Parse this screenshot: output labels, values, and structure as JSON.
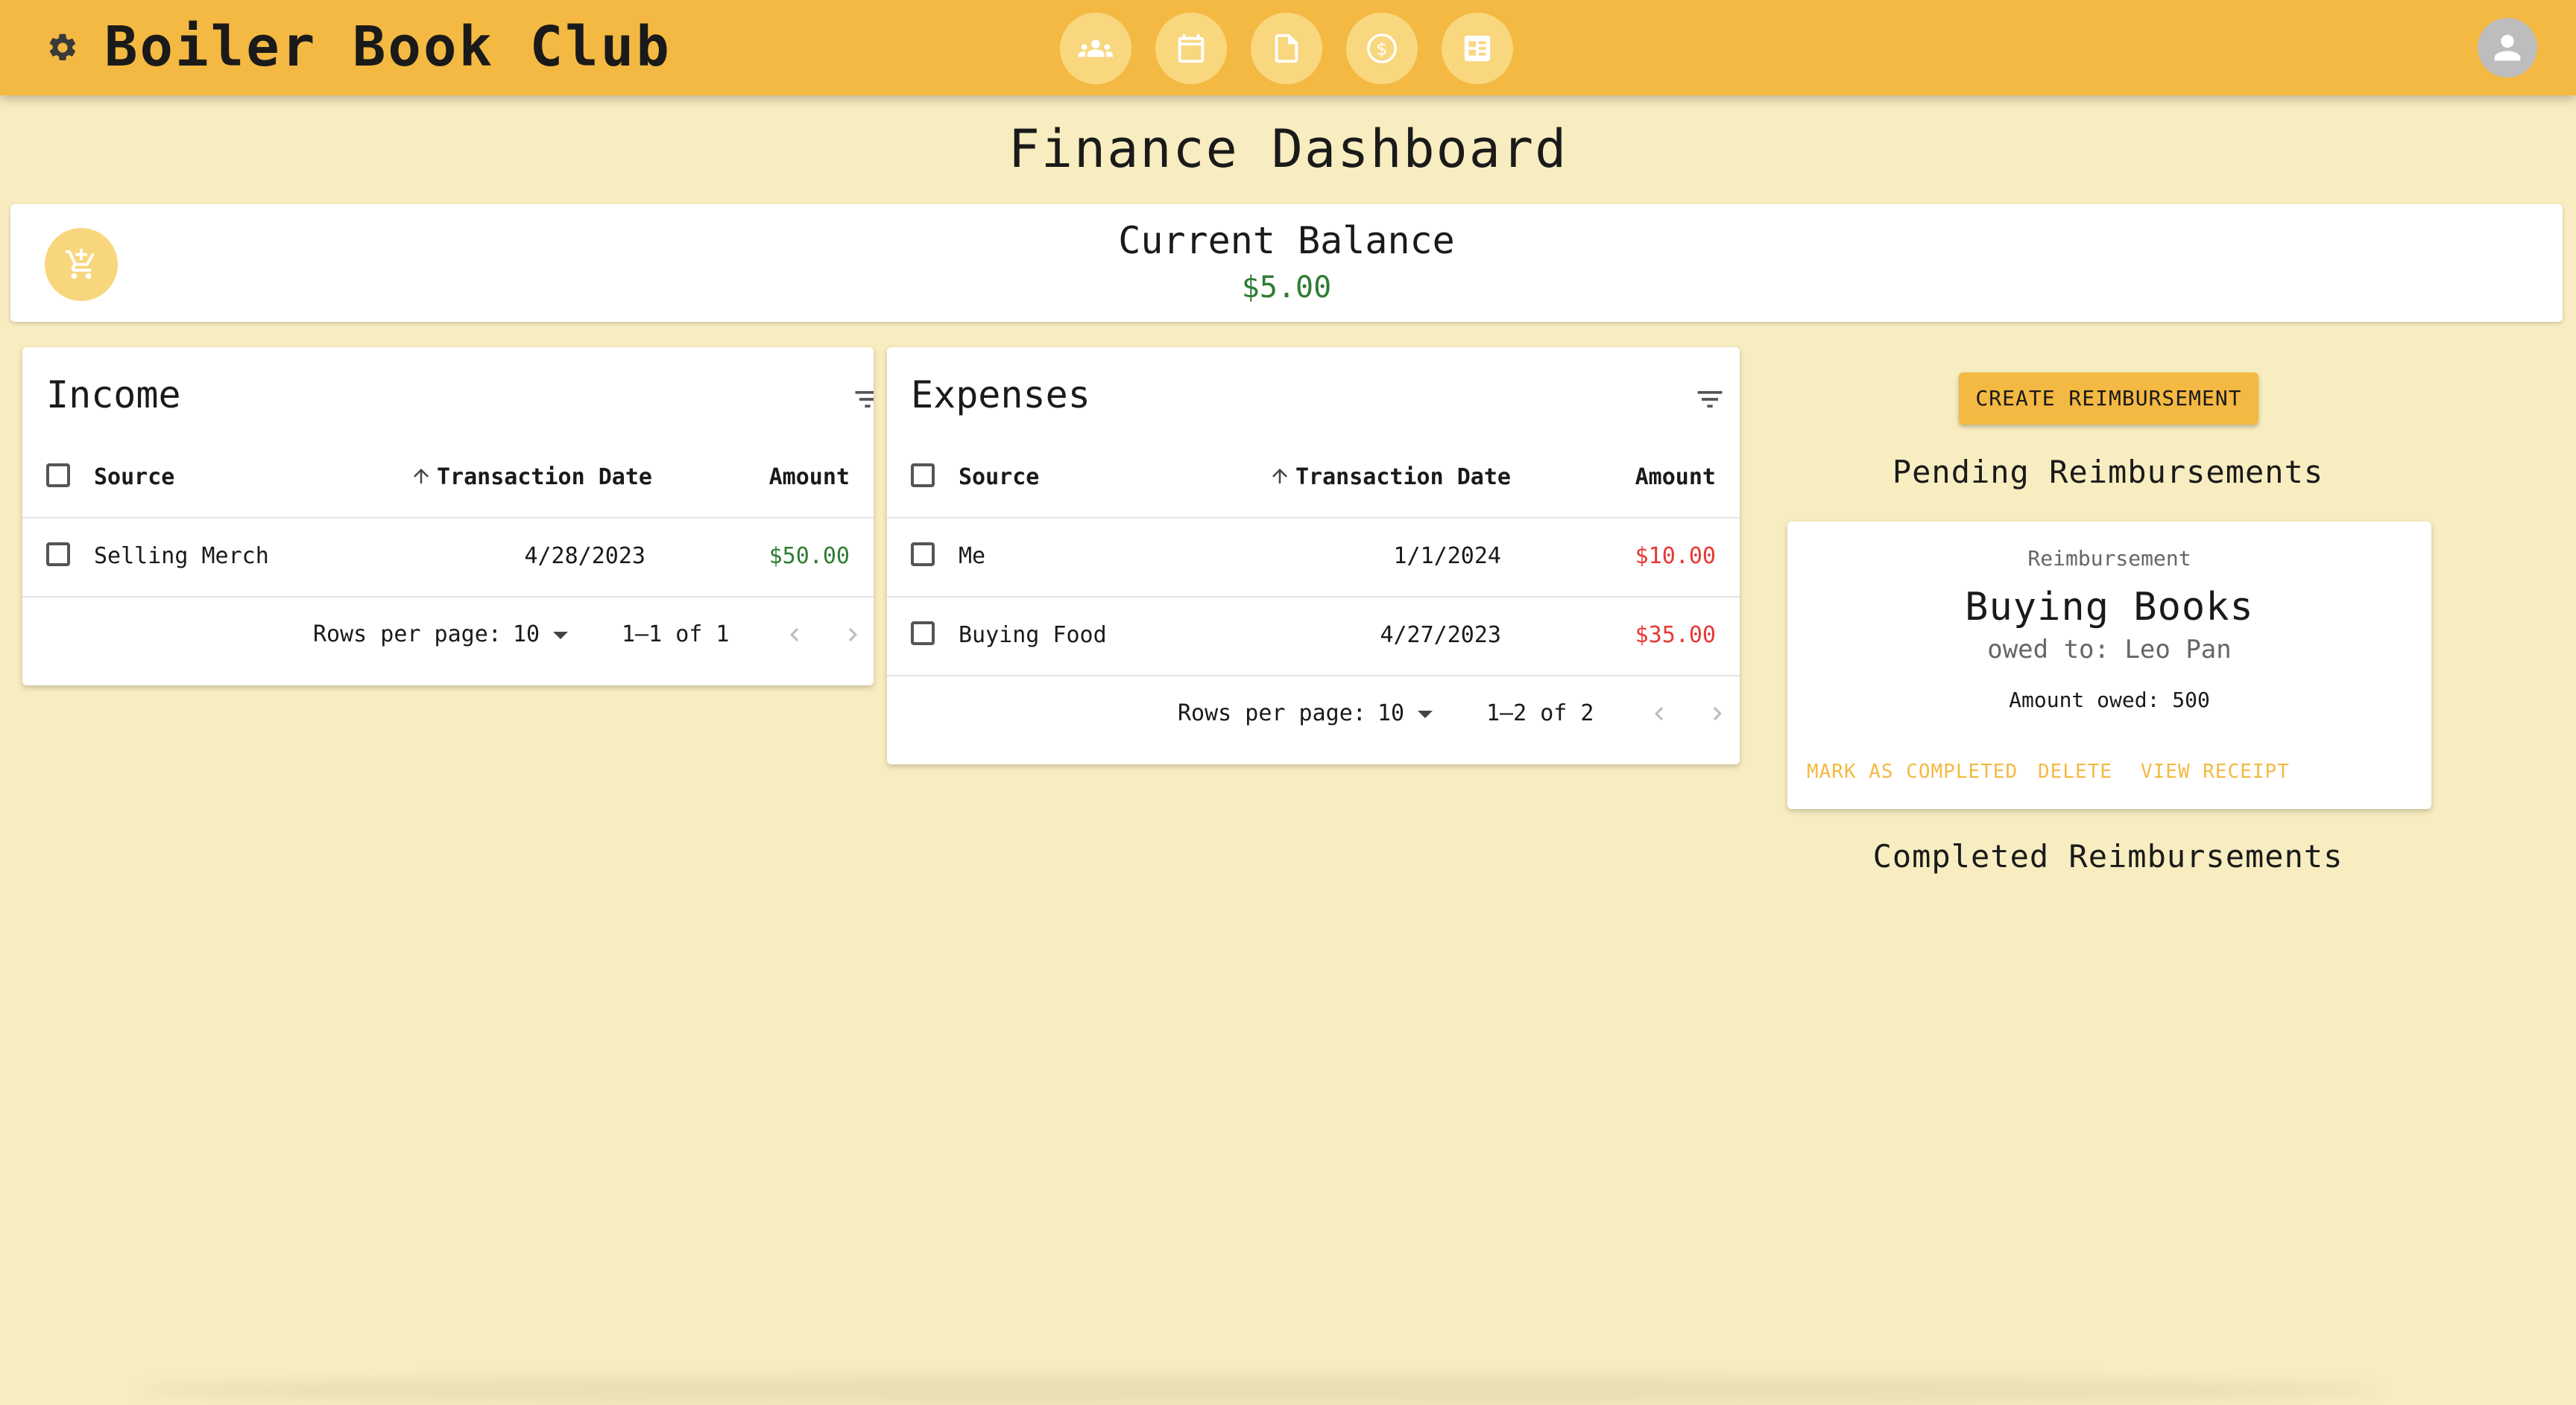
{
  "header": {
    "brand": "Boiler Book Club",
    "nav": [
      {
        "icon": "group-icon"
      },
      {
        "icon": "calendar-icon"
      },
      {
        "icon": "document-icon"
      },
      {
        "icon": "dollar-icon"
      },
      {
        "icon": "list-icon"
      }
    ],
    "avatar_icon": "person-icon"
  },
  "page": {
    "title": "Finance Dashboard"
  },
  "balance": {
    "label": "Current Balance",
    "value": "$5.00",
    "action_icon": "add-cart-icon"
  },
  "income": {
    "title": "Income",
    "columns": {
      "source": "Source",
      "date": "Transaction Date",
      "amount": "Amount"
    },
    "rows": [
      {
        "source": "Selling Merch",
        "date": "4/28/2023",
        "amount": "$50.00"
      }
    ],
    "footer": {
      "rows_label": "Rows per page:",
      "rows_value": "10",
      "range": "1–1 of 1"
    }
  },
  "expenses": {
    "title": "Expenses",
    "columns": {
      "source": "Source",
      "date": "Transaction Date",
      "amount": "Amount"
    },
    "rows": [
      {
        "source": "Me",
        "date": "1/1/2024",
        "amount": "$10.00"
      },
      {
        "source": "Buying Food",
        "date": "4/27/2023",
        "amount": "$35.00"
      }
    ],
    "footer": {
      "rows_label": "Rows per page:",
      "rows_value": "10",
      "range": "1–2 of 2"
    }
  },
  "reimbursements": {
    "create_label": "CREATE REIMBURSEMENT",
    "pending_heading": "Pending Reimbursements",
    "completed_heading": "Completed Reimbursements",
    "pending": [
      {
        "overline": "Reimbursement",
        "title": "Buying Books",
        "owed_to": "owed to: Leo Pan",
        "amount": "Amount owed: 500",
        "actions": {
          "complete": "MARK AS COMPLETED",
          "delete": "DELETE",
          "receipt": "VIEW RECEIPT"
        }
      }
    ]
  },
  "colors": {
    "appbar": "#f4b942",
    "background": "#f8edc0",
    "income_amount": "#2e7d32",
    "expense_amount": "#e53935",
    "accent_text": "#f4b942"
  }
}
